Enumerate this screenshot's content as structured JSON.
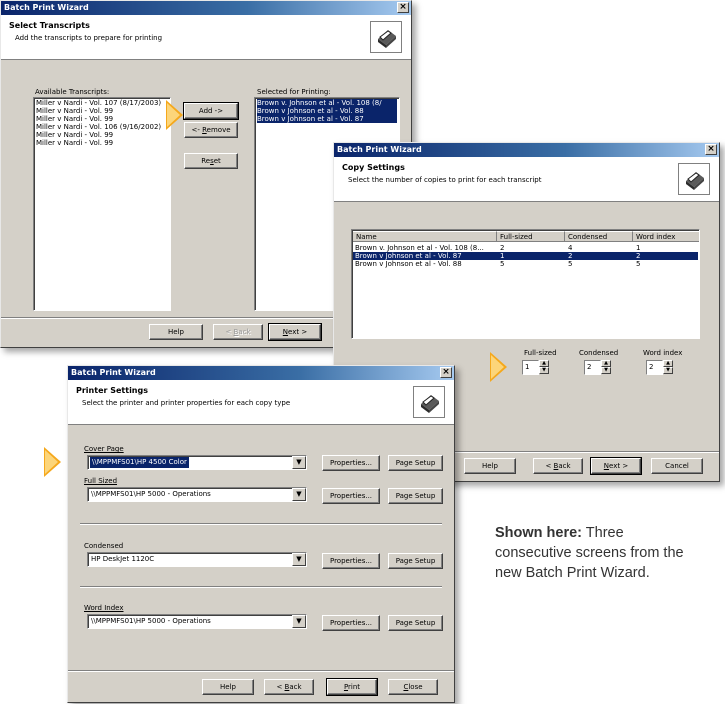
{
  "win1": {
    "title": "Batch Print Wizard",
    "close": "×",
    "header_title": "Select Transcripts",
    "header_sub": "Add the transcripts to prepare for printing",
    "available_label": "Available Transcripts:",
    "selected_label": "Selected for Printing:",
    "available": [
      "Miller v Nardi - Vol. 107 (8/17/2003)",
      "Miller v Nardi - Vol. 99",
      "Miller v Nardi - Vol. 99",
      "Miller v Nardi - Vol. 106 (9/16/2002)",
      "Miller v Nardi - Vol. 99",
      "Miller v Nardi - Vol. 99"
    ],
    "selected": [
      "Brown v. Johnson et al - Vol. 108 (8/",
      "Brown v Johnson et al - Vol. 88",
      "Brown v Johnson et al - Vol. 87"
    ],
    "add": "Add ->",
    "remove_pre": "<- ",
    "remove_u": "R",
    "remove_post": "emove",
    "reset_pre": "Re",
    "reset_u": "s",
    "reset_post": "et",
    "help": "Help",
    "back_pre": "< ",
    "back_u": "B",
    "back_post": "ack",
    "next_u": "N",
    "next_post": "ext >"
  },
  "win2": {
    "title": "Batch Print Wizard",
    "close": "×",
    "header_title": "Copy Settings",
    "header_sub": "Select the number of copies to print for each transcript",
    "columns": [
      "Name",
      "Full-sized",
      "Condensed",
      "Word index"
    ],
    "rows": [
      {
        "name": "Brown v. Johnson et al - Vol. 108 (8...",
        "full": "2",
        "cond": "4",
        "word": "1"
      },
      {
        "name": "Brown v Johnson et al - Vol. 87",
        "full": "1",
        "cond": "2",
        "word": "2"
      },
      {
        "name": "Brown v Johnson et al - Vol. 88",
        "full": "5",
        "cond": "5",
        "word": "5"
      }
    ],
    "spin_full_label": "Full-sized",
    "spin_cond_label": "Condensed",
    "spin_word_label": "Word index",
    "spin_full": "1",
    "spin_cond": "2",
    "spin_word": "2",
    "help": "Help",
    "back_pre": "< ",
    "back_u": "B",
    "back_post": "ack",
    "next_u": "N",
    "next_post": "ext >",
    "cancel": "Cancel"
  },
  "win3": {
    "title": "Batch Print Wizard",
    "close": "×",
    "header_title": "Printer Settings",
    "header_sub": "Select the printer and printer properties for each copy type",
    "sections": [
      {
        "label": "Cover Page",
        "value": "\\\\MPPMFS01\\HP 4500 Color",
        "properties": "Properties...",
        "page_setup": "Page Setup"
      },
      {
        "label": "Full Sized",
        "value": "\\\\MPPMFS01\\HP 5000 - Operations",
        "properties": "Properties...",
        "page_setup": "Page Setup"
      },
      {
        "label": "Condensed",
        "value": "HP DeskJet 1120C",
        "properties": "Properties...",
        "page_setup": "Page Setup"
      },
      {
        "label": "Word Index",
        "value": "\\\\MPPMFS01\\HP 5000 - Operations",
        "properties": "Properties...",
        "page_setup": "Page Setup"
      }
    ],
    "help": "Help",
    "back_pre": "< ",
    "back_u": "B",
    "back_post": "ack",
    "print_u": "P",
    "print_post": "rint",
    "close_u": "C",
    "close_post": "lose"
  },
  "caption": {
    "bold": "Shown here:",
    "text": " Three consecutive screens from the new Batch Print Wizard."
  },
  "colors": {
    "highlight_arrow": "#f5a81c",
    "selection": "#0a246a",
    "dialog_face": "#d4d0c8"
  },
  "icons": [
    "printer-icon",
    "arrow-pointer-icon",
    "close-icon",
    "dropdown-arrow-icon",
    "spin-up-icon",
    "spin-down-icon"
  ]
}
